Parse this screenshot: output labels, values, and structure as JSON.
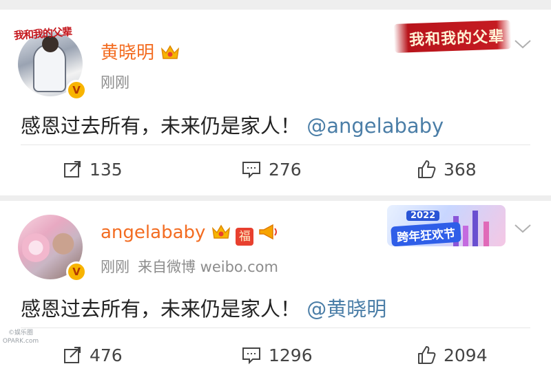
{
  "posts": [
    {
      "username": "黄晓明",
      "time": "刚刚",
      "source": "",
      "content_text": "感恩过去所有，未来仍是家人！",
      "mention": "@angelababy",
      "reposts": "135",
      "comments": "276",
      "likes": "368",
      "banner_text": "我和我的父辈",
      "corner_logo_text": "我和我的父辈",
      "badges": [
        "crown-icon"
      ]
    },
    {
      "username": "angelababy",
      "time": "刚刚",
      "source": "来自微博 weibo.com",
      "content_text": "感恩过去所有，未来仍是家人！",
      "mention": "@黄晓明",
      "reposts": "476",
      "comments": "1296",
      "likes": "2094",
      "banner_year": "2022",
      "banner_title": "跨年狂欢节",
      "fu_char": "福",
      "badges": [
        "crown-icon",
        "fu-icon",
        "horn-icon"
      ]
    }
  ],
  "watermark": {
    "line1": "©娱乐圈",
    "line2": "OPARK.com"
  },
  "colors": {
    "username": "#f36c21",
    "mention": "#4b7ea7",
    "meta": "#8c8c8c"
  }
}
